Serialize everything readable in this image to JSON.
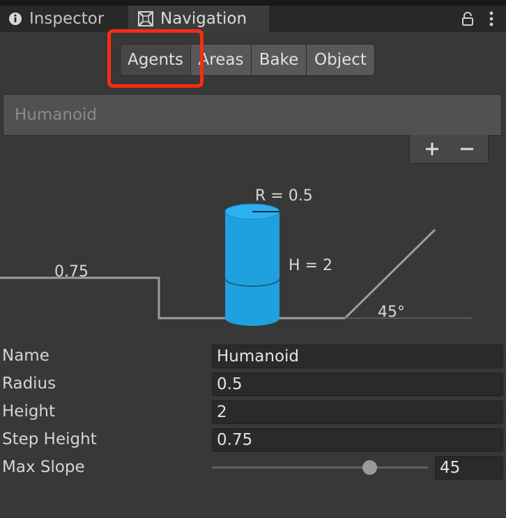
{
  "tabs": {
    "inspector": {
      "label": "Inspector",
      "icon": "info-icon"
    },
    "navigation": {
      "label": "Navigation",
      "icon": "navmesh-icon"
    },
    "actions": [
      "lock-icon",
      "more-options-icon"
    ]
  },
  "segments": [
    {
      "label": "Agents",
      "active": true
    },
    {
      "label": "Areas",
      "active": false
    },
    {
      "label": "Bake",
      "active": false
    },
    {
      "label": "Object",
      "active": false
    }
  ],
  "highlight_color": "#ff2a12",
  "agent_list": {
    "items": [
      "Humanoid"
    ],
    "add_icon": "plus-icon",
    "remove_icon": "minus-icon"
  },
  "diagram": {
    "radius_label": "R = 0.5",
    "height_label": "H = 2",
    "step_label": "0.75",
    "slope_label": "45°",
    "agent_color": "#1fa1e0"
  },
  "fields": {
    "name": {
      "label": "Name",
      "value": "Humanoid"
    },
    "radius": {
      "label": "Radius",
      "value": "0.5"
    },
    "height": {
      "label": "Height",
      "value": "2"
    },
    "step_height": {
      "label": "Step Height",
      "value": "0.75"
    },
    "max_slope": {
      "label": "Max Slope",
      "value": "45",
      "fraction": 0.73
    }
  }
}
